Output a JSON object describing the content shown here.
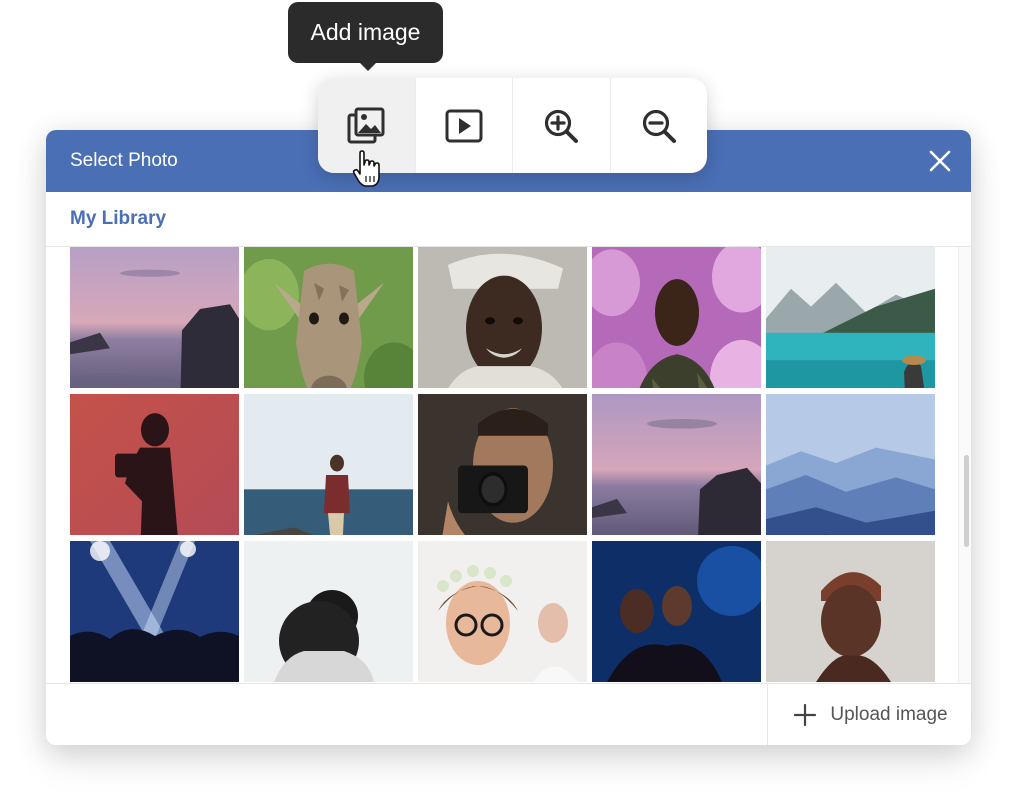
{
  "tooltip": {
    "text": "Add image"
  },
  "toolbar": {
    "buttons": [
      {
        "icon": "add-image-icon",
        "active": true
      },
      {
        "icon": "play-video-icon",
        "active": false
      },
      {
        "icon": "zoom-in-icon",
        "active": false
      },
      {
        "icon": "zoom-out-icon",
        "active": false
      }
    ]
  },
  "dialog": {
    "title": "Select Photo",
    "close_icon": "close-icon",
    "library_label": "My Library",
    "upload_label": "Upload image",
    "header_color": "#4a6fb5",
    "accent_color": "#4a6fb5"
  },
  "photos": [
    {
      "subject": "sunset-coast-rocks"
    },
    {
      "subject": "giraffe-closeup"
    },
    {
      "subject": "elderly-man-portrait"
    },
    {
      "subject": "man-in-pink-flowers"
    },
    {
      "subject": "turquoise-mountain-lake"
    },
    {
      "subject": "photographer-silhouette"
    },
    {
      "subject": "man-on-seaside-rocks"
    },
    {
      "subject": "man-with-camera"
    },
    {
      "subject": "sunset-coast-rocks-2"
    },
    {
      "subject": "misty-blue-mountains"
    },
    {
      "subject": "concert-crowd-lights"
    },
    {
      "subject": "woman-hair-bun"
    },
    {
      "subject": "women-flower-crowns"
    },
    {
      "subject": "friends-night-blue"
    },
    {
      "subject": "woman-headwrap-portrait"
    }
  ]
}
